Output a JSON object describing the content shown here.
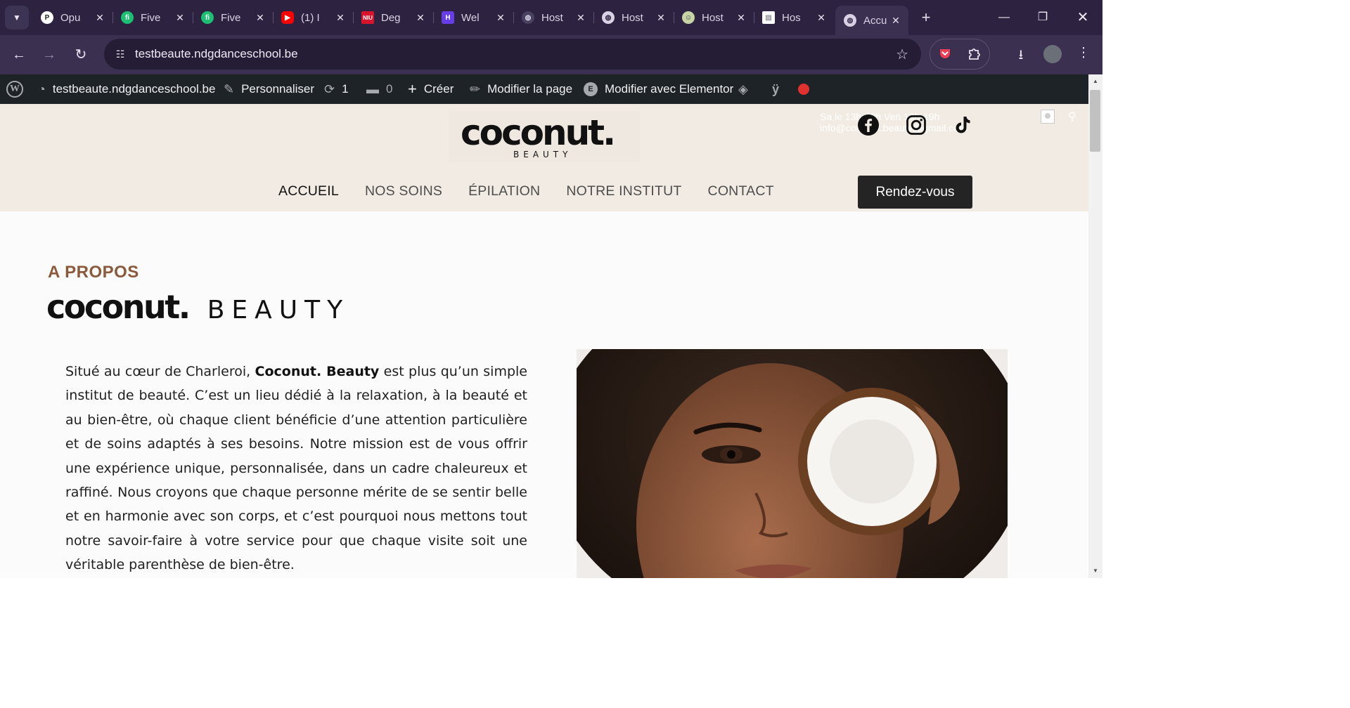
{
  "browser": {
    "tabs": [
      {
        "label": "Opu",
        "icon": "pocket-round-icon",
        "color": "#ffffff"
      },
      {
        "label": "Five",
        "icon": "fiverr-icon",
        "color": "#1dbf73"
      },
      {
        "label": "Five",
        "icon": "fiverr-icon",
        "color": "#1dbf73"
      },
      {
        "label": "(1) I",
        "icon": "youtube-icon",
        "color": "#ff0000"
      },
      {
        "label": "Deg",
        "icon": "niu-icon",
        "color": "#d7142c"
      },
      {
        "label": "Wel",
        "icon": "hostinger-icon",
        "color": "#673de6"
      },
      {
        "label": "Host",
        "icon": "globe-icon",
        "color": "#d8d2e4"
      },
      {
        "label": "Host",
        "icon": "globe-icon",
        "color": "#d8d2e4"
      },
      {
        "label": "Host",
        "icon": "smiley-globe-icon",
        "color": "#c9d4a6"
      },
      {
        "label": "Hos",
        "icon": "page-icon",
        "color": "#ffffff"
      },
      {
        "label": "Accu",
        "icon": "globe-icon",
        "color": "#d8d2e4",
        "active": true
      }
    ],
    "url": "testbeaute.ndgdanceschool.be"
  },
  "adminbar": {
    "site": "testbeaute.ndgdanceschool.be",
    "customize": "Personnaliser",
    "updates": "1",
    "comments": "0",
    "new": "Créer",
    "edit_page": "Modifier la page",
    "elementor": "Modifier avec Elementor"
  },
  "site": {
    "logo_main": "coconut.",
    "logo_sub": "BEAUTY",
    "topline": "Sa  le  13h-19h    Ven   13h-19h    info@coconut.beauty@gmail.com",
    "nav": [
      "ACCUEIL",
      "NOS SOINS",
      "ÉPILATION",
      "NOTRE INSTITUT",
      "CONTACT"
    ],
    "cta": "Rendez-vous",
    "eyebrow": "A PROPOS",
    "brand_main": "coconut.",
    "brand_sub": "BEAUTY",
    "about_pre": "Situé au cœur de Charleroi, ",
    "about_bold": "Coconut. Beauty",
    "about_post": " est plus qu’un simple institut de beauté. C’est un lieu dédié à la relaxation, à la beauté et au bien-être, où chaque client bénéficie d’une attention particulière et de soins adaptés à ses besoins. Notre mission est de vous offrir une expérience unique, personnalisée, dans un cadre chaleureux et raffiné. Nous croyons que chaque personne mérite de se sentir belle et en harmonie avec son corps, et c’est pourquoi nous mettons tout notre savoir-faire à votre service pour que chaque visite soit une véritable parenthèse de bien-être."
  }
}
